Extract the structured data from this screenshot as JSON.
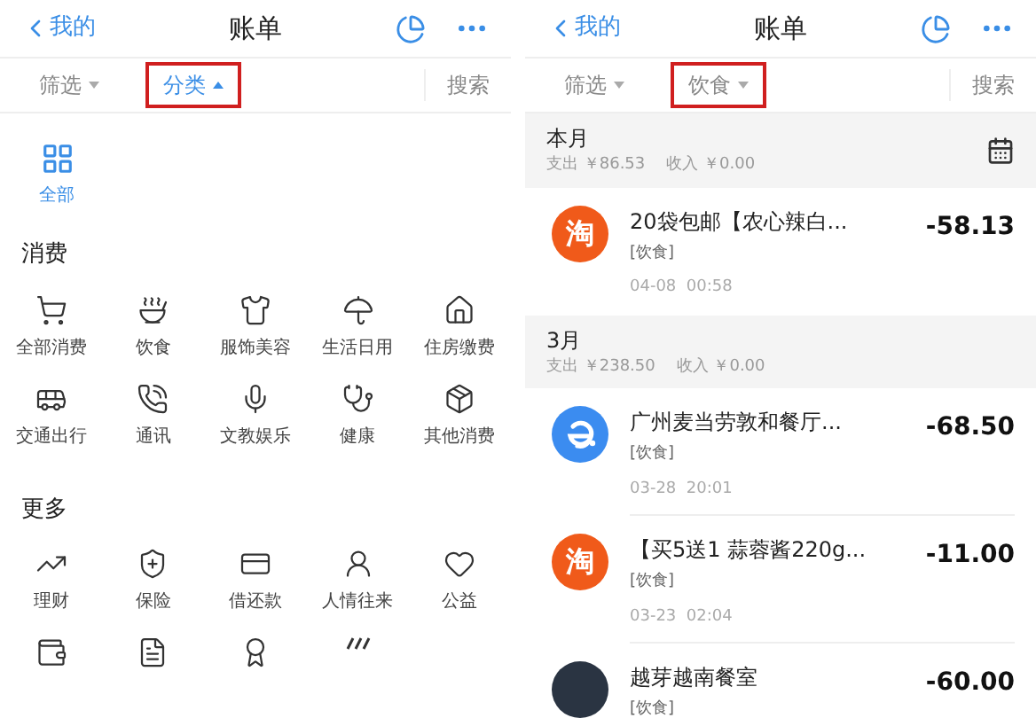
{
  "screens": [
    {
      "kind": "categories",
      "header": {
        "back": "我的",
        "title": "账单"
      },
      "filters": [
        {
          "label": "筛选",
          "selected": false,
          "expanded": false,
          "highlighted": false
        },
        {
          "label": "分类",
          "selected": true,
          "expanded": true,
          "highlighted": true
        }
      ],
      "search": "搜索",
      "all_option": {
        "label": "全部",
        "selected": true
      },
      "sections": [
        {
          "title": "消费",
          "items": [
            {
              "label": "全部消费"
            },
            {
              "label": "饮食"
            },
            {
              "label": "服饰美容"
            },
            {
              "label": "生活日用"
            },
            {
              "label": "住房缴费"
            },
            {
              "label": "交通出行"
            },
            {
              "label": "通讯"
            },
            {
              "label": "文教娱乐"
            },
            {
              "label": "健康"
            },
            {
              "label": "其他消费"
            }
          ]
        },
        {
          "title": "更多",
          "items": [
            {
              "label": "理财"
            },
            {
              "label": "保险"
            },
            {
              "label": "借还款"
            },
            {
              "label": "人情往来"
            },
            {
              "label": "公益"
            }
          ]
        }
      ]
    },
    {
      "kind": "bills",
      "header": {
        "back": "我的",
        "title": "账单"
      },
      "filters": [
        {
          "label": "筛选",
          "selected": false,
          "expanded": false,
          "highlighted": false
        },
        {
          "label": "饮食",
          "selected": false,
          "expanded": false,
          "highlighted": true
        }
      ],
      "search": "搜索",
      "months": [
        {
          "title": "本月",
          "expense": "支出 ￥86.53",
          "income": "收入 ￥0.00",
          "transactions": [
            {
              "kind": "taobao",
              "avatar_text": "淘",
              "title": "20袋包邮【农心辣白...",
              "category": "[饮食]",
              "time": "04-08  00:58",
              "amount": "-58.13"
            }
          ]
        },
        {
          "title": "3月",
          "expense": "支出 ￥238.50",
          "income": "收入 ￥0.00",
          "transactions": [
            {
              "kind": "eleme",
              "title": "广州麦当劳敦和餐厅...",
              "category": "[饮食]",
              "time": "03-28  20:01",
              "amount": "-68.50"
            },
            {
              "kind": "taobao",
              "avatar_text": "淘",
              "title": "【买5送1 蒜蓉酱220g...",
              "category": "[饮食]",
              "time": "03-23  02:04",
              "amount": "-11.00"
            },
            {
              "kind": "photo",
              "title": "越芽越南餐室",
              "category": "[饮食]",
              "amount": "-60.00"
            }
          ]
        }
      ]
    }
  ]
}
